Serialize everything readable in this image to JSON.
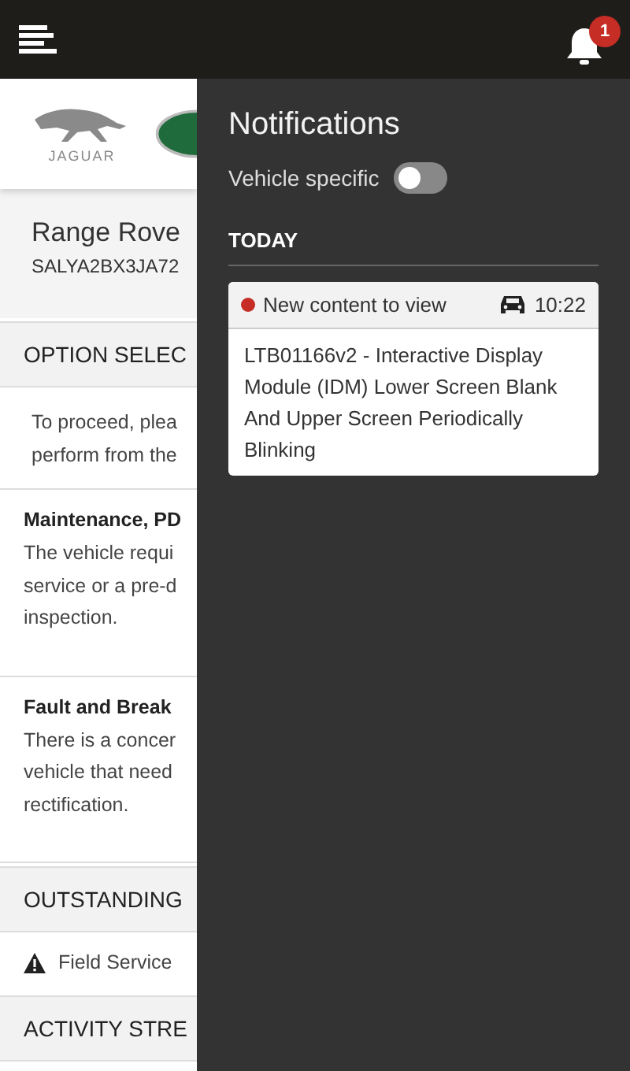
{
  "top_bar": {
    "notification_count": "1"
  },
  "brand": {
    "wordmark": "JAGUAR"
  },
  "vehicle": {
    "model": "Range Rove",
    "vin": "SALYA2BX3JA72"
  },
  "sections": [
    {
      "kind": "bar",
      "text": "OPTION SELEC"
    },
    {
      "kind": "paragraph",
      "lines": [
        "To proceed, plea",
        "perform from the"
      ]
    },
    {
      "kind": "option",
      "title": "Maintenance, PD",
      "lines": [
        "The vehicle requi",
        "service or a pre-d",
        "inspection."
      ]
    },
    {
      "kind": "option",
      "title": "Fault and Break",
      "lines": [
        "There is a concer",
        "vehicle that need",
        "rectification."
      ]
    },
    {
      "kind": "bar",
      "text": "OUTSTANDING"
    },
    {
      "kind": "warning",
      "text": "Field Service"
    },
    {
      "kind": "bar",
      "text": "ACTIVITY STRE"
    }
  ],
  "notifications": {
    "title": "Notifications",
    "vehicle_specific": {
      "label": "Vehicle specific",
      "on": false
    },
    "groups": [
      {
        "label": "TODAY",
        "items": [
          {
            "unread": true,
            "status": "New content to view",
            "time": "10:22",
            "text": "LTB01166v2 - Interactive Display Module (IDM) Lower Screen Blank And Upper Screen Periodically Blinking"
          }
        ]
      }
    ]
  }
}
